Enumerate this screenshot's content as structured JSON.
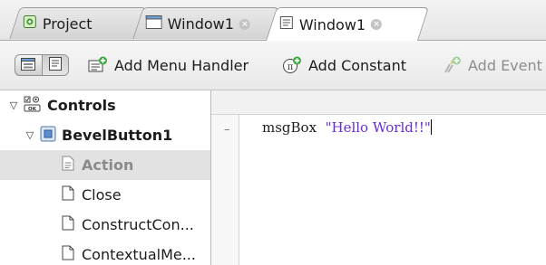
{
  "tabs": [
    {
      "label": "Project",
      "icon": "project-icon",
      "active": false
    },
    {
      "label": "Window1",
      "icon": "window-icon",
      "active": false,
      "closable": true
    },
    {
      "label": "Window1",
      "icon": "code-editor-icon",
      "active": true,
      "closable": true
    }
  ],
  "close_glyph": "×",
  "toolbar": {
    "view_toggle": [
      "layout-view-icon",
      "code-view-icon"
    ],
    "add_menu_handler": "Add Menu Handler",
    "add_constant": "Add Constant",
    "add_event": "Add Event"
  },
  "tree": {
    "group": "Controls",
    "control": "BevelButton1",
    "events": [
      {
        "label": "Action",
        "selected": true
      },
      {
        "label": "Close",
        "selected": false
      },
      {
        "label": "ConstructCon...",
        "selected": false
      },
      {
        "label": "ContextualMe...",
        "selected": false
      }
    ]
  },
  "editor": {
    "fold_marker": "–",
    "keyword": "msgBox",
    "string": "\"Hello World!!\""
  },
  "colors": {
    "string": "#6a2bd2",
    "selection": "#e2e2e2",
    "disabled_text": "#8d8d8d"
  }
}
